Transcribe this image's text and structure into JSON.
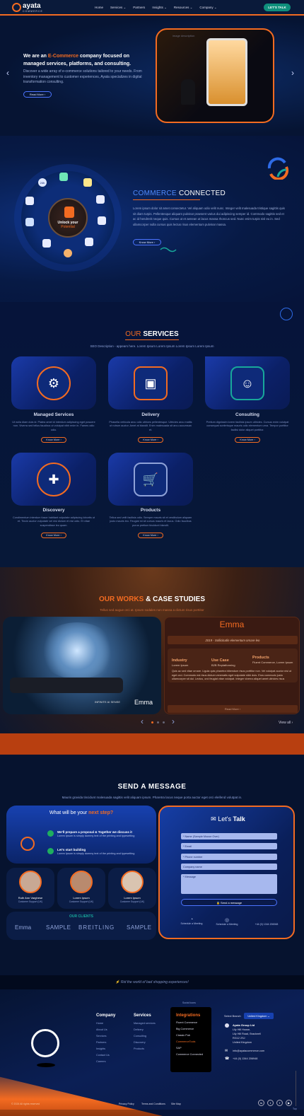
{
  "nav": {
    "brand": "ayata",
    "brand_sub": "COMMERCE",
    "links": [
      "Home",
      "Services ⌄",
      "Partners",
      "Insights ⌄",
      "Resources ⌄",
      "Company ⌄"
    ],
    "cta": "LET'S TALK"
  },
  "hero": {
    "headline_pre": "We are an ",
    "headline_hl": "E-Commerce",
    "headline_post": " company focused on managed services, platforms, and consulting.",
    "body": "Discover a wide array of e-commerce solutions tailored to your needs. From inventory management to customer experiences, Ayata specializes in digital transformation consulting.",
    "button": "Read More",
    "image_caption": "image description"
  },
  "connected": {
    "title_a": "COMMERCE",
    "title_b": "CONNECTED",
    "body": "Lorem ipsum dolor sit amet consectetur. Vel aliquam odio velit nunc. Integer velit malesuada tristique sagittis quis sit diam turpis. Pellentesque aliquam pulvinar praesent varius dui adipiscing semper id. Commodo sagittis sed et ac id hendrerit neque quis. Cursus ut et aenean ut lacus massa rhoncus sed. Nunc enim turpis nisl eu in. Sed ullamcorper nulla cursus quis lectus risus elementum pulvinar massa.",
    "button": "Know More",
    "wheel_title": "Unlock your",
    "wheel_sub": "Potential",
    "wheel_badge": "24h"
  },
  "services": {
    "title_a": "OUR",
    "title_b": "SERVICES",
    "subtitle": "SEO Description - appears here. Lorem Ipsum Lorem Ipsum Lorem Ipsum Lorem Ipsum",
    "button": "Know More",
    "cards": [
      {
        "name": "Managed Services",
        "desc": "Ut nulla diam duis id. Platea amet id interdum adipiscing eget posuere non. Viverra sed tellus faucibus ut volutpat nibh enim in. Fames odio odio."
      },
      {
        "name": "Delivery",
        "desc": "Phasella vehicula arcu odio ultrices pellentesque. Ultricies arcu mattis ut rutrum auctor. Amet at blandit. Enim malesuada sit arcu accumsan et."
      },
      {
        "name": "Consulting",
        "desc": "Pretium dignissim lorem facilisis ipsum ultricies. Cursus enim volutpat consequat scelerisque mauris odio elementum urna. Tempor porttitor facilisi dolor aliquet porttitor."
      },
      {
        "name": "Discovery",
        "desc": "Condimentum interdum fusce habitant vulputate adipiscing lobortis ut et. Tincin auctor vulputate vel nisi dictum et nisl odio. Et vitae suspendisse leo quam."
      },
      {
        "name": "Products",
        "desc": "Tellus sed velit facilisis odio. Semper mauris sit et vestibulum aliquam justo mauris leo. Feugiat mi sit cursus mauris et lacus. Odio faucibus purus pretium tincidunt blandit."
      }
    ]
  },
  "works": {
    "title_a": "OUR WORKS",
    "title_b": "& CASE STUDIES",
    "subtitle": "Tellus sed augue orci at. Ipsum sodales non massa a dictum risus porttitor",
    "client": "Emma",
    "tagline": "2019 - Sollicitudin elementum ornare leo",
    "stats": [
      {
        "label": "Industry",
        "value": "Lorem Ipsum"
      },
      {
        "label": "Use Case",
        "value": "B2B Replatforming"
      },
      {
        "label": "Products",
        "value": "Fluent Commerce, Lorem Ipsum"
      }
    ],
    "body": "Quis ac sed vitae ornare. Ligula quis pharetra bibendum risus porttitor non. Vel volutpat auctor nisl ut eget orci. Commodo est risus dictum venenatis eget vulputate nibh duis. Eros commodo justo ullamcorper sit dui. Lectus, orci feugiat vitae volutpat. Integer viverra aliquet amet ultricies risus tincidunt.",
    "read_more": "Read More",
    "view_all": "View all",
    "image_label": "INFINITE AI SENSE"
  },
  "message": {
    "title": "SEND A MESSAGE",
    "subtitle": "Mauris gravida tincidunt malesuada sagittis velit aliquam ipsum. Pharetra lacus neque porta auctor eget orci eleifend volutpat in.",
    "next_step_a": "What will be your",
    "next_step_b": "next step?",
    "steps": [
      {
        "title": "We'll prepare a proposal & Together we discuss it",
        "text": "Lorem Ipsum is simply dummy text of the printing and typesetting"
      },
      {
        "title": "Let's start building",
        "text": "Lorem Ipsum is simply dummy text of the printing and typesetting"
      }
    ],
    "team": [
      {
        "name": "Ruth Ann Varghese",
        "role": "Customer Support (UK)"
      },
      {
        "name": "Lorem Ipsum",
        "role": "Customer Support (UK)"
      },
      {
        "name": "Lorem Ipsum",
        "role": "Customer Support (UK)"
      }
    ],
    "clients_title": "OUR CLIENTS",
    "clients": [
      "Emma",
      "SAMPLE",
      "BREITLING",
      "SAMPLE"
    ],
    "form_title_a": "Let's",
    "form_title_b": "Talk",
    "fields": [
      "* Name (Sample Mouse Over)",
      "* Email",
      "* Phone number",
      "Company name",
      "* Message"
    ],
    "submit": "Send a message",
    "contacts": [
      "Schedule a Meeting",
      "Schedule a Meeting",
      "+44 (0) 1344 206948"
    ]
  },
  "tagline": "Rid the world of bad shopping experiences!",
  "footer": {
    "social_label": "Social Icons",
    "company_title": "Company",
    "company_links": [
      "Home",
      "About Us",
      "Services",
      "Partners",
      "Insights",
      "Contact Us",
      "Careers"
    ],
    "services_title": "Services",
    "services_links": [
      "Managed services",
      "Delivery",
      "Consulting",
      "Discovery",
      "Products"
    ],
    "integrations_title": "Integrations",
    "integrations_links": [
      "Fluent Commerce",
      "Big Commerce",
      "Classic Pub",
      "CommerceTools",
      "SAP",
      "Commerce Connected"
    ],
    "select_label": "Select Branch",
    "branch": "United Kingdom ⌄",
    "address": [
      "Ayata Group Ltd",
      "Lily Hill House,",
      "Lily Hill Road, Bracknell",
      "RG12 2SJ",
      "United Kingdom"
    ],
    "email": "info@ayatacommerce.com",
    "phone": "+44 (0) 1344 206948",
    "copyright": "© 2024 All rights reserved",
    "legal": [
      "Privacy Policy",
      "Terms and Conditions",
      "Site Map"
    ],
    "top": "Top"
  },
  "colors": {
    "accent": "#f36b21",
    "navy": "#06132f",
    "blue": "#1741b0",
    "teal": "#0f8f7c"
  }
}
